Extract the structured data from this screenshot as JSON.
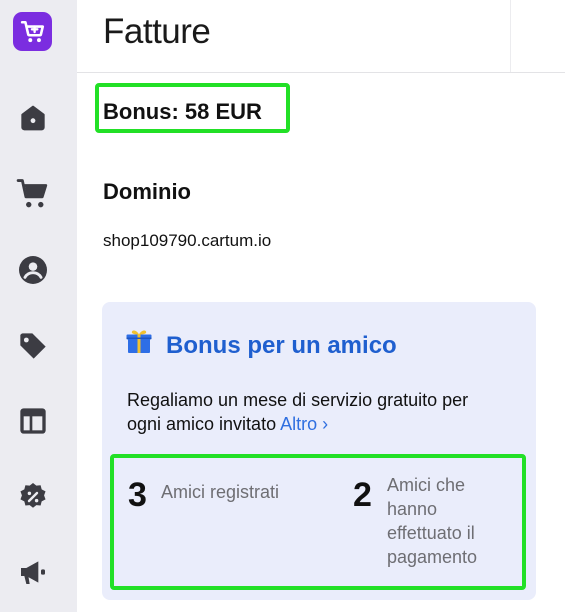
{
  "sidebar": {
    "logo_icon": "cart-logo-icon",
    "accent": "#7b2de0",
    "items": [
      {
        "icon": "home-icon"
      },
      {
        "icon": "cart-icon"
      },
      {
        "icon": "user-icon"
      },
      {
        "icon": "tag-icon"
      },
      {
        "icon": "layout-icon"
      },
      {
        "icon": "discount-badge-icon"
      },
      {
        "icon": "megaphone-icon"
      }
    ]
  },
  "header": {
    "title": "Fatture"
  },
  "main": {
    "bonus_balance": "Bonus: 58 EUR",
    "domain_heading": "Dominio",
    "domain_value": "shop109790.cartum.io"
  },
  "referral_card": {
    "icon": "gift-icon",
    "title": "Bonus per un amico",
    "description": "Regaliamo un mese di servizio gratuito per ogni amico invitato",
    "more_link": "Altro ›",
    "stats": [
      {
        "value": "3",
        "label": "Amici registrati"
      },
      {
        "value": "2",
        "label": "Amici che hanno effettuato il pagamento"
      }
    ]
  },
  "highlight_color": "#22e026"
}
